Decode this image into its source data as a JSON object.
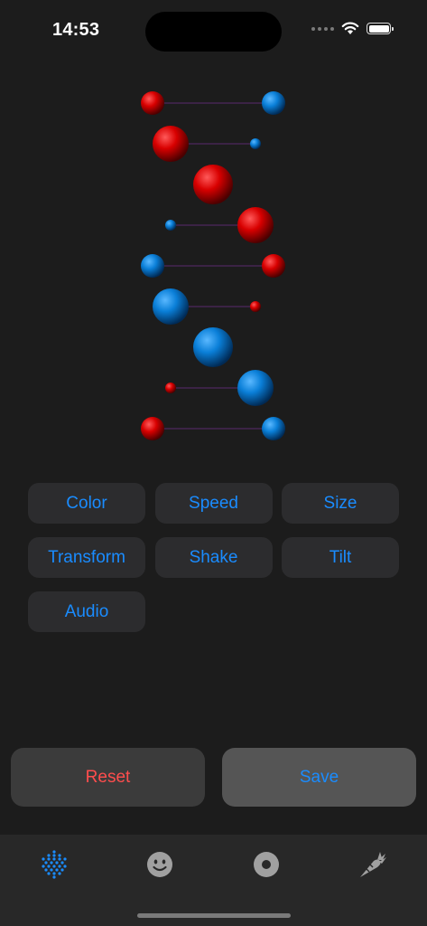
{
  "status": {
    "time": "14:53"
  },
  "helix": {
    "colors": {
      "red": "#e00000",
      "blue": "#0a7fd8",
      "connector": "#5a2a6e"
    },
    "rows": [
      {
        "left": "red",
        "left_size": "medium",
        "right": "blue",
        "right_size": "medium"
      },
      {
        "left": "red",
        "left_size": "large",
        "right": "blue",
        "right_size": "small"
      },
      {
        "left": "red",
        "left_size": "large",
        "right": "red",
        "right_size": "large",
        "merged": true
      },
      {
        "left": "blue",
        "left_size": "small",
        "right": "red",
        "right_size": "large"
      },
      {
        "left": "blue",
        "left_size": "medium",
        "right": "red",
        "right_size": "medium"
      },
      {
        "left": "blue",
        "left_size": "large",
        "right": "red",
        "right_size": "small"
      },
      {
        "left": "blue",
        "left_size": "large",
        "right": "blue",
        "right_size": "large",
        "merged": true
      },
      {
        "left": "red",
        "left_size": "small",
        "right": "blue",
        "right_size": "large"
      },
      {
        "left": "red",
        "left_size": "medium",
        "right": "blue",
        "right_size": "medium"
      }
    ]
  },
  "options": [
    "Color",
    "Speed",
    "Size",
    "Transform",
    "Shake",
    "Tilt",
    "Audio"
  ],
  "actions": {
    "reset": "Reset",
    "save": "Save"
  },
  "tabbar": {
    "tabs": [
      {
        "icon": "helix-dots-icon",
        "selected": true
      },
      {
        "icon": "smiley-icon",
        "selected": false
      },
      {
        "icon": "record-icon",
        "selected": false
      },
      {
        "icon": "carrot-icon",
        "selected": false
      }
    ],
    "accent": "#1a8cff",
    "inactive": "#a0a0a0"
  }
}
